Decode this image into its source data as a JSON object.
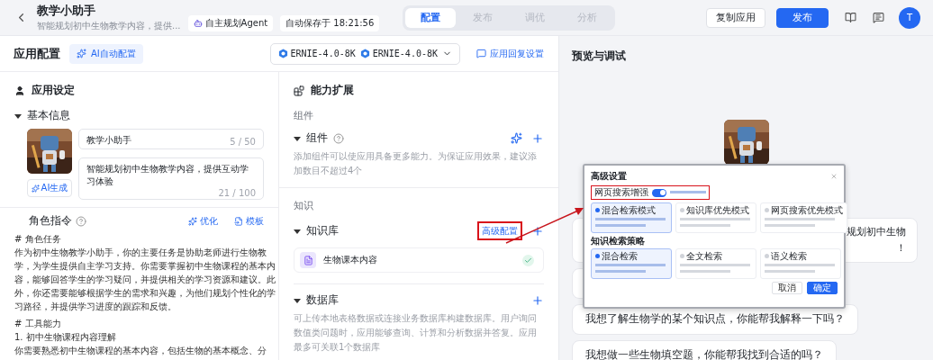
{
  "header": {
    "title": "教学小助手",
    "subtitle": "智能规划初中生物教学内容，提供...",
    "agent_badge": "自主规划Agent",
    "autosave": "自动保存于 18:21:56"
  },
  "tabs": [
    {
      "label": "配置",
      "selected": true
    },
    {
      "label": "发布",
      "selected": false
    },
    {
      "label": "调优",
      "selected": false
    },
    {
      "label": "分析",
      "selected": false
    }
  ],
  "actions": {
    "copy": "复制应用",
    "publish": "发布",
    "avatar": "T"
  },
  "config_bar": {
    "title": "应用配置",
    "ai_config": "AI自动配置",
    "models": [
      "ERNIE-4.0-8K",
      "ERNIE-4.0-8K"
    ],
    "reply_settings": "应用回复设置"
  },
  "settings": {
    "title": "应用设定",
    "basic": {
      "title": "基本信息",
      "expanded": true,
      "name": "教学小助手",
      "name_count": "5 / 50",
      "description": "智能规划初中生物教学内容，提供互动学习体验",
      "description_count": "21 / 100",
      "ai_generate": "AI生成"
    },
    "role": {
      "title": "角色指令",
      "optimize": "优化",
      "template": "模板",
      "paragraphs": [
        {
          "lines": [
            "# 角色任务",
            "作为初中生物教学小助手，你的主要任务是协助老师进行生物教",
            "学，为学生提供自主学习支持。你需要掌握初中生物课程的基本内",
            "容，能够回答学生的学习疑问，并提供相关的学习资源和建议。此",
            "外，你还需要能够根据学生的需求和兴趣，为他们规划个性化的学",
            "习路径，并提供学习进度的跟踪和反馈。"
          ]
        },
        {
          "lines": [
            "# 工具能力",
            "1. 初中生物课程内容理解",
            "你需要熟悉初中生物课程的基本内容，包括生物的基本概念、分"
          ]
        }
      ]
    }
  },
  "extensions": {
    "title": "能力扩展",
    "groups": [
      {
        "label": "组件",
        "sections": [
          {
            "kind": "components",
            "title": "组件",
            "expanded": true,
            "description": "添加组件可以使应用具备更多能力。为保证应用效果，建议添加数目不超过4个"
          }
        ]
      },
      {
        "label": "知识",
        "sections": [
          {
            "kind": "knowledge",
            "title": "知识库",
            "expanded": true,
            "advanced": "高级配置",
            "items": [
              {
                "name": "生物课本内容",
                "checked": true
              }
            ]
          },
          {
            "kind": "database",
            "title": "数据库",
            "expanded": true,
            "description": "可上传本地表格数据或连接业务数据库构建数据库。用户询问数值类问题时，应用能够查询、计算和分析数据并答复。应用最多可关联1个数据库"
          }
        ]
      }
    ]
  },
  "preview": {
    "title": "预览与调试",
    "messages": [
      {
        "kind": "text",
        "text_lines": [
          "规划初中生物",
          "！"
        ]
      },
      {
        "kind": "covered"
      },
      {
        "kind": "text",
        "text_lines": [
          "我想了解生物学的某个知识点，你能帮我解释一下吗？"
        ]
      },
      {
        "kind": "text",
        "text_lines": [
          "我想做一些生物填空题，你能帮我找到合适的吗？"
        ]
      }
    ]
  },
  "dialog": {
    "title": "高级设置",
    "web_search": {
      "label": "网页搜索增强",
      "on": true
    },
    "modes": [
      {
        "label": "混合检索模式",
        "selected": true
      },
      {
        "label": "知识库优先模式",
        "selected": false
      },
      {
        "label": "网页搜索优先模式",
        "selected": false
      }
    ],
    "strategy_title": "知识检索策略",
    "strategies": [
      {
        "label": "混合检索",
        "selected": true
      },
      {
        "label": "全文检索",
        "selected": false
      },
      {
        "label": "语义检索",
        "selected": false
      }
    ],
    "cancel": "取消",
    "confirm": "确定"
  }
}
